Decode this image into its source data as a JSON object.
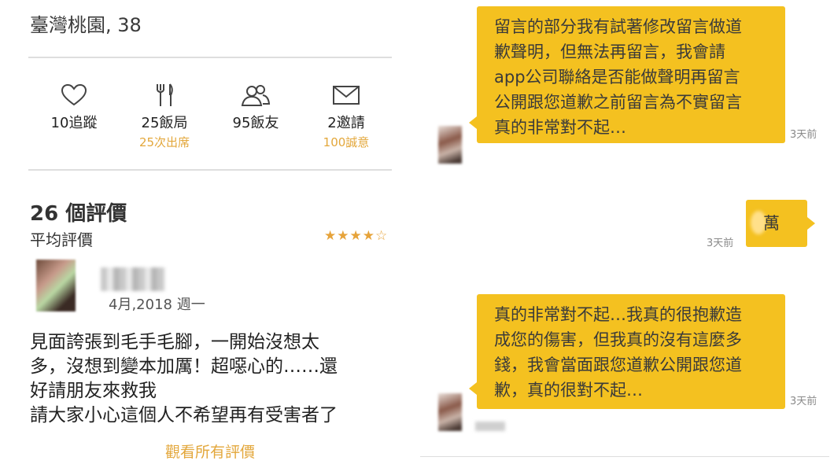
{
  "profile": {
    "location": "臺灣桃園, 38",
    "stats": [
      {
        "icon": "heart-icon",
        "label": "10追蹤",
        "sub": ""
      },
      {
        "icon": "utensils-icon",
        "label": "25飯局",
        "sub": "25次出席"
      },
      {
        "icon": "friends-icon",
        "label": "95飯友",
        "sub": ""
      },
      {
        "icon": "mail-icon",
        "label": "2邀請",
        "sub": "100誠意"
      }
    ]
  },
  "reviews": {
    "title": "26 個評價",
    "average_label": "平均評價",
    "stars": "★★★★☆",
    "rating": 4,
    "item": {
      "date": "4月,2018 週一",
      "text_lines": [
        "見面誇張到毛手毛腳，一開始沒想太",
        "多，沒想到變本加厲！超噁心的……還",
        "好請朋友來救我",
        "請大家小心這個人不希望再有受害者了"
      ]
    },
    "see_all": "觀看所有評價"
  },
  "chat": {
    "messages": [
      {
        "side": "left",
        "lines": [
          "留言的部分我有試著修改留言做道",
          "歉聲明，但無法再留言，我會請",
          "app公司聯絡是否能做聲明再留言",
          "公開跟您道歉之前留言為不實留言",
          "真的非常對不起…"
        ],
        "time": "3天前"
      },
      {
        "side": "right",
        "lines": [
          "萬"
        ],
        "time": "3天前"
      },
      {
        "side": "left",
        "lines": [
          "真的非常對不起…我真的很抱歉造",
          "成您的傷害，但我真的沒有這麼多",
          "錢，我會當面跟您道歉公開跟您道",
          "歉，真的很對不起…"
        ],
        "time": "3天前"
      }
    ]
  },
  "colors": {
    "accent": "#e3a73b",
    "bubble": "#f4c120",
    "divider": "#dedede"
  }
}
